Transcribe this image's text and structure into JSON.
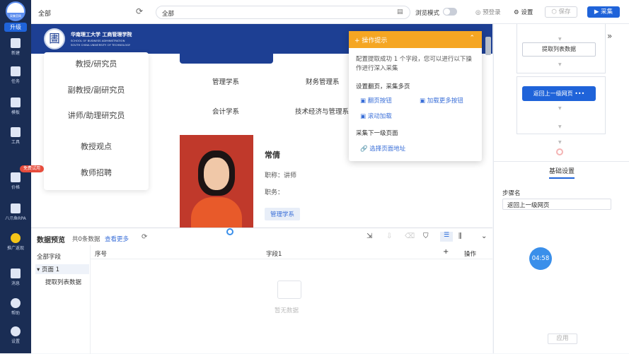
{
  "sidebar": {
    "logo_text": "采集官网",
    "upgrade_label": "升级",
    "items": [
      {
        "label": "新建",
        "icon": "plus-icon"
      },
      {
        "label": "任务",
        "icon": "task-icon"
      },
      {
        "label": "模板",
        "icon": "template-icon"
      },
      {
        "label": "工具",
        "icon": "toolbox-icon"
      },
      {
        "label": "价格",
        "icon": "crown-icon",
        "badge": "免费试用"
      },
      {
        "label": "八爪鱼RPA",
        "icon": "rpa-icon"
      },
      {
        "label": "推广返现",
        "icon": "coin-icon"
      },
      {
        "label": "消息",
        "icon": "bell-icon"
      },
      {
        "label": "帮助",
        "icon": "help-icon"
      },
      {
        "label": "设置",
        "icon": "settings-icon"
      }
    ]
  },
  "topbar": {
    "scope_label": "全部",
    "url_value": "全部",
    "browse_mode_label": "浏览模式",
    "preview_login_label": "预登录",
    "settings_label": "设置",
    "save_label": "保存",
    "collect_label": "采集"
  },
  "webpage": {
    "school_name_cn": "华南理工大学 工商管理学院",
    "school_name_en_1": "SCHOOL OF BUSINESS ADMINISTRATION",
    "school_name_en_2": "SOUTH CHINA UNIVERSITY OF TECHNOLOGY",
    "menu": [
      "教授/研究员",
      "副教授/副研究员",
      "讲师/助理研究员",
      "教授观点",
      "教师招聘"
    ],
    "categories": [
      "管理学系",
      "财务管理系",
      "会计学系",
      "技术经济与管理系"
    ],
    "profile": {
      "name": "常倩",
      "title_label": "职称：",
      "title_value": "讲师",
      "position_label": "职务：",
      "department_tag": "管理学系"
    }
  },
  "tip": {
    "title": "操作提示",
    "message": "配置提取成功 1 个字段，您可以进行以下操作进行深入采集",
    "section_paging": "设置翻页，采集多页",
    "link_next_page": "翻页按钮",
    "link_load_more": "加载更多按钮",
    "link_scroll": "滚动加载",
    "section_subpage": "采集下一级页面",
    "link_select_url": "选择页面地址"
  },
  "flow": {
    "step_extract": "提取列表数据",
    "step_return": "返回上一级网页"
  },
  "settings_panel": {
    "tab_label": "基础设置",
    "step_name_label": "步骤名",
    "step_name_value": "返回上一级网页",
    "apply_label": "应用",
    "timer": "04:58"
  },
  "preview": {
    "title": "数据预览",
    "count_text": "共0条数据",
    "view_more": "查看更多",
    "tree_root": "全部字段",
    "tree_page": "页面 1",
    "tree_child": "提取列表数据",
    "col_index": "序号",
    "col_field": "字段1",
    "col_plus": "+",
    "col_action": "操作",
    "empty_text": "暂无数据"
  },
  "colors": {
    "sidebar_bg": "#1a2d54",
    "primary": "#1f63d9",
    "banner": "#1d3f93",
    "tip_header": "#f5a623",
    "badge": "#e74c3c"
  }
}
